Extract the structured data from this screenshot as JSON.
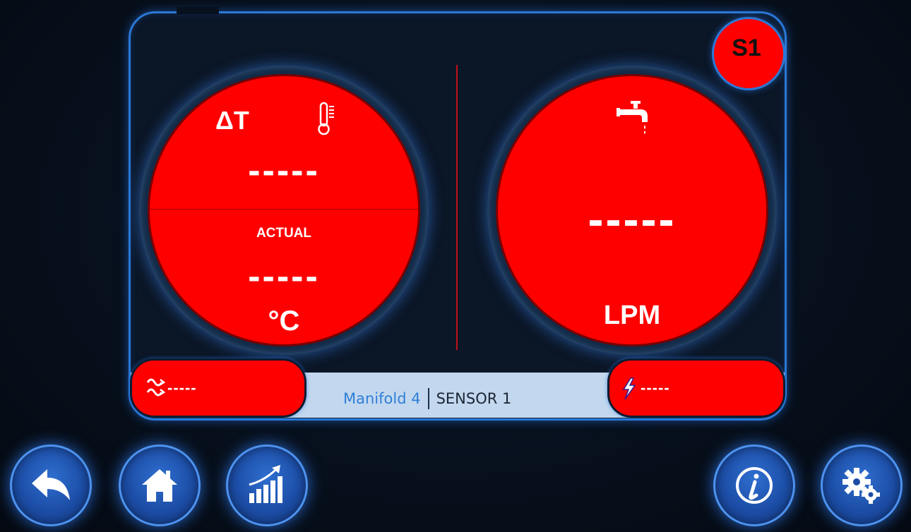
{
  "badge": {
    "label": "S1"
  },
  "temperature_gauge": {
    "symbol": "ΔT",
    "set_value": "-----",
    "actual_label": "ACTUAL",
    "actual_value": "-----",
    "unit": "°C",
    "icon": "thermometer-icon"
  },
  "flow_gauge": {
    "value": "-----",
    "unit": "LPM",
    "icon": "water-tap-icon"
  },
  "status_bar": {
    "left_value": "-----",
    "left_icon": "heat-wave-icon",
    "manifold": "Manifold 4",
    "sensor": "SENSOR 1",
    "right_value": "-----",
    "right_icon": "lightning-icon"
  },
  "nav": {
    "back": "back-arrow-icon",
    "home": "home-icon",
    "chart": "bar-chart-icon",
    "info": "info-icon",
    "settings": "gears-icon"
  },
  "colors": {
    "alert_red": "#ff0000",
    "frame_blue": "#2b78d6",
    "button_blue": "#1c4da6",
    "bar_light": "#c3d8ee",
    "manifold_text": "#2f7fd8"
  }
}
